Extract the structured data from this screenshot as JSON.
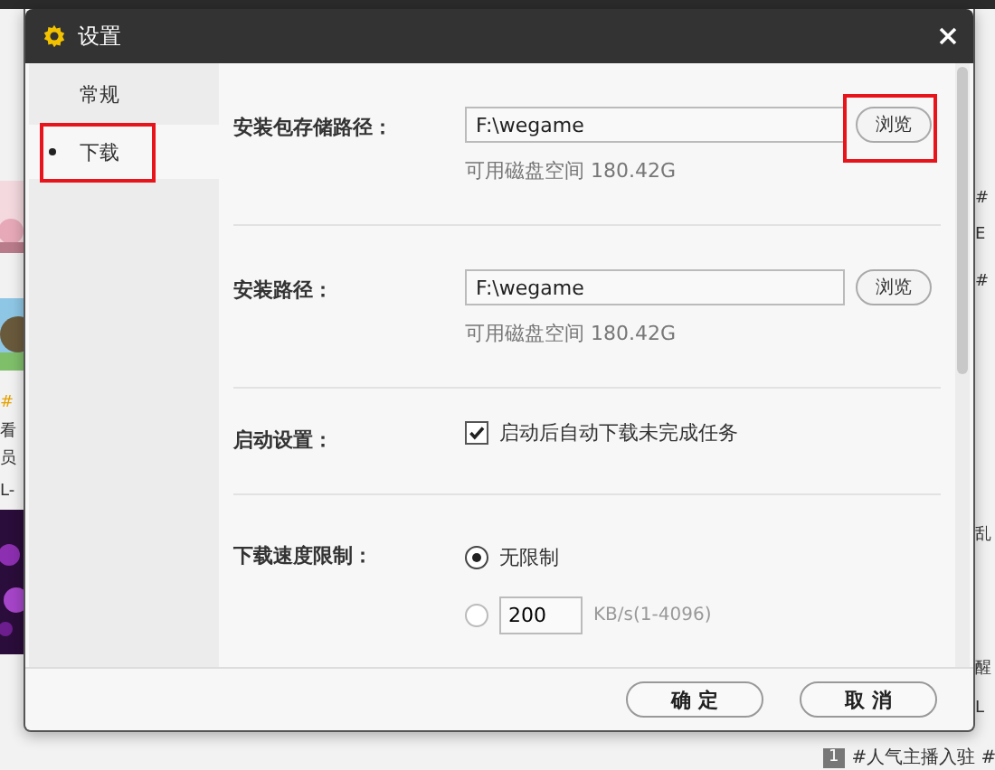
{
  "background": {
    "left_texts": [
      {
        "text": "#",
        "accent": true
      },
      {
        "text": "看",
        "accent": false
      },
      {
        "text": "员",
        "accent": false
      },
      {
        "text": "L-",
        "accent": false
      }
    ],
    "right_texts": [
      "#",
      "E",
      "#",
      "乱",
      "醒",
      "L"
    ],
    "footer_badge": "1",
    "footer_text": "#人气主播入驻 #"
  },
  "dialog": {
    "title": "设置",
    "sidebar": [
      {
        "label": "常规",
        "selected": false,
        "highlighted": false
      },
      {
        "label": "下载",
        "selected": true,
        "highlighted": true
      }
    ],
    "settings": [
      {
        "kind": "path",
        "label": "安装包存储路径：",
        "value": "F:\\wegame",
        "button": "浏览",
        "highlighted": true,
        "note": "可用磁盘空间 180.42G"
      },
      {
        "kind": "path",
        "label": "安装路径：",
        "value": "F:\\wegame",
        "button": "浏览",
        "highlighted": false,
        "note": "可用磁盘空间 180.42G"
      },
      {
        "kind": "checkbox",
        "label": "启动设置：",
        "option": "启动后自动下载未完成任务",
        "checked": true
      },
      {
        "kind": "speed",
        "label": "下载速度限制：",
        "options": [
          {
            "kind": "plain",
            "label": "无限制",
            "selected": true
          },
          {
            "kind": "input",
            "value": "200",
            "unit": "KB/s(1-4096)",
            "selected": false
          }
        ]
      }
    ],
    "buttons": [
      "确 定",
      "取 消"
    ]
  }
}
